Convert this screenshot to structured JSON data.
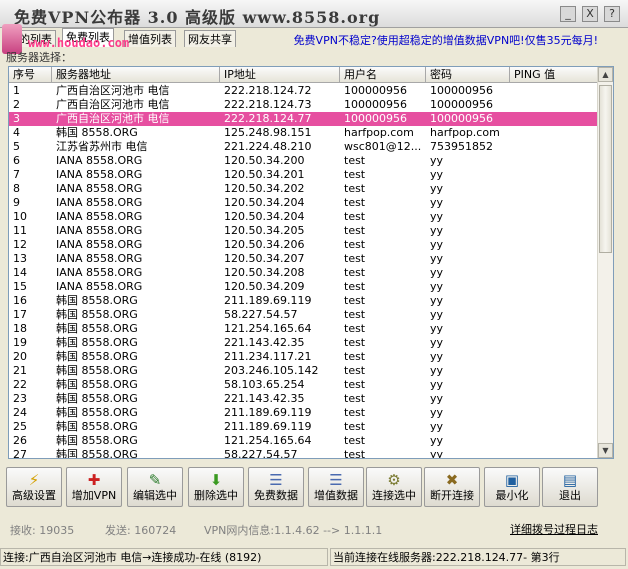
{
  "window": {
    "title": "免费VPN公布器  3.0 高级版 www.8558.org",
    "controls": [
      "_",
      "X",
      "?"
    ]
  },
  "watermark": {
    "text": "www.houdao.com"
  },
  "tabs": [
    {
      "label": "我的列表"
    },
    {
      "label": "免费列表"
    },
    {
      "label": "增值列表"
    },
    {
      "label": "网友共享"
    }
  ],
  "ad_text": "免费VPN不稳定?使用超稳定的增值数据VPN吧!仅售35元每月!",
  "group_label": "服务器选择：",
  "table": {
    "columns": [
      "序号",
      "服务器地址",
      "IP地址",
      "用户名",
      "密码",
      "PING 值"
    ],
    "selected_index": 2,
    "rows": [
      [
        "1",
        "广西自治区河池市 电信",
        "222.218.124.72",
        "100000956",
        "100000956",
        ""
      ],
      [
        "2",
        "广西自治区河池市 电信",
        "222.218.124.73",
        "100000956",
        "100000956",
        ""
      ],
      [
        "3",
        "广西自治区河池市 电信",
        "222.218.124.77",
        "100000956",
        "100000956",
        ""
      ],
      [
        "4",
        "韩国  8558.ORG",
        "125.248.98.151",
        "harfpop.com",
        "harfpop.com",
        ""
      ],
      [
        "5",
        "江苏省苏州市 电信",
        "221.224.48.210",
        "wsc801@12...",
        "753951852",
        ""
      ],
      [
        "6",
        "IANA  8558.ORG",
        "120.50.34.200",
        "test",
        "yy",
        ""
      ],
      [
        "7",
        "IANA  8558.ORG",
        "120.50.34.201",
        "test",
        "yy",
        ""
      ],
      [
        "8",
        "IANA  8558.ORG",
        "120.50.34.202",
        "test",
        "yy",
        ""
      ],
      [
        "9",
        "IANA  8558.ORG",
        "120.50.34.204",
        "test",
        "yy",
        ""
      ],
      [
        "10",
        "IANA  8558.ORG",
        "120.50.34.204",
        "test",
        "yy",
        ""
      ],
      [
        "11",
        "IANA  8558.ORG",
        "120.50.34.205",
        "test",
        "yy",
        ""
      ],
      [
        "12",
        "IANA  8558.ORG",
        "120.50.34.206",
        "test",
        "yy",
        ""
      ],
      [
        "13",
        "IANA  8558.ORG",
        "120.50.34.207",
        "test",
        "yy",
        ""
      ],
      [
        "14",
        "IANA  8558.ORG",
        "120.50.34.208",
        "test",
        "yy",
        ""
      ],
      [
        "15",
        "IANA  8558.ORG",
        "120.50.34.209",
        "test",
        "yy",
        ""
      ],
      [
        "16",
        "韩国  8558.ORG",
        "211.189.69.119",
        "test",
        "yy",
        ""
      ],
      [
        "17",
        "韩国  8558.ORG",
        "58.227.54.57",
        "test",
        "yy",
        ""
      ],
      [
        "18",
        "韩国  8558.ORG",
        "121.254.165.64",
        "test",
        "yy",
        ""
      ],
      [
        "19",
        "韩国  8558.ORG",
        "221.143.42.35",
        "test",
        "yy",
        ""
      ],
      [
        "20",
        "韩国  8558.ORG",
        "211.234.117.21",
        "test",
        "yy",
        ""
      ],
      [
        "21",
        "韩国  8558.ORG",
        "203.246.105.142",
        "test",
        "yy",
        ""
      ],
      [
        "22",
        "韩国  8558.ORG",
        "58.103.65.254",
        "test",
        "yy",
        ""
      ],
      [
        "23",
        "韩国  8558.ORG",
        "221.143.42.35",
        "test",
        "yy",
        ""
      ],
      [
        "24",
        "韩国  8558.ORG",
        "211.189.69.119",
        "test",
        "yy",
        ""
      ],
      [
        "25",
        "韩国  8558.ORG",
        "211.189.69.119",
        "test",
        "yy",
        ""
      ],
      [
        "26",
        "韩国  8558.ORG",
        "121.254.165.64",
        "test",
        "yy",
        ""
      ],
      [
        "27",
        "韩国  8558.ORG",
        "58.227.54.57",
        "test",
        "yy",
        ""
      ]
    ]
  },
  "toolbar": [
    {
      "label": "高级设置",
      "icon": "lightning-icon",
      "glyph": "⚡",
      "color": "#d4a000"
    },
    {
      "label": "增加VPN",
      "icon": "add-vpn-icon",
      "glyph": "✚",
      "color": "#cc2020"
    },
    {
      "label": "编辑选中",
      "icon": "edit-icon",
      "glyph": "✎",
      "color": "#2a7a2a"
    },
    {
      "label": "删除选中",
      "icon": "delete-icon",
      "glyph": "⬇",
      "color": "#3a9a20"
    },
    {
      "label": "免费数据",
      "icon": "free-data-icon",
      "glyph": "☰",
      "color": "#4a6ab0"
    },
    {
      "label": "增值数据",
      "icon": "paid-data-icon",
      "glyph": "☰",
      "color": "#4a6ab0"
    },
    {
      "label": "连接选中",
      "icon": "connect-icon",
      "glyph": "⚙",
      "color": "#7a7a30"
    },
    {
      "label": "断开连接",
      "icon": "disconnect-icon",
      "glyph": "✖",
      "color": "#8a6a20"
    },
    {
      "label": "最小化",
      "icon": "minimize-icon",
      "glyph": "▣",
      "color": "#2060a0"
    },
    {
      "label": "退出",
      "icon": "exit-icon",
      "glyph": "▤",
      "color": "#2060a0"
    }
  ],
  "info": {
    "received": "接收: 19035",
    "sent": "发送: 160724",
    "vpn_info": "VPN网内信息:1.1.4.62 --> 1.1.1.1",
    "detail_link": "详细拨号过程日志"
  },
  "status": {
    "left": "连接:广西自治区河池市 电信→连接成功-在线 (8192)",
    "right": "当前连接在线服务器:222.218.124.77- 第3行"
  }
}
